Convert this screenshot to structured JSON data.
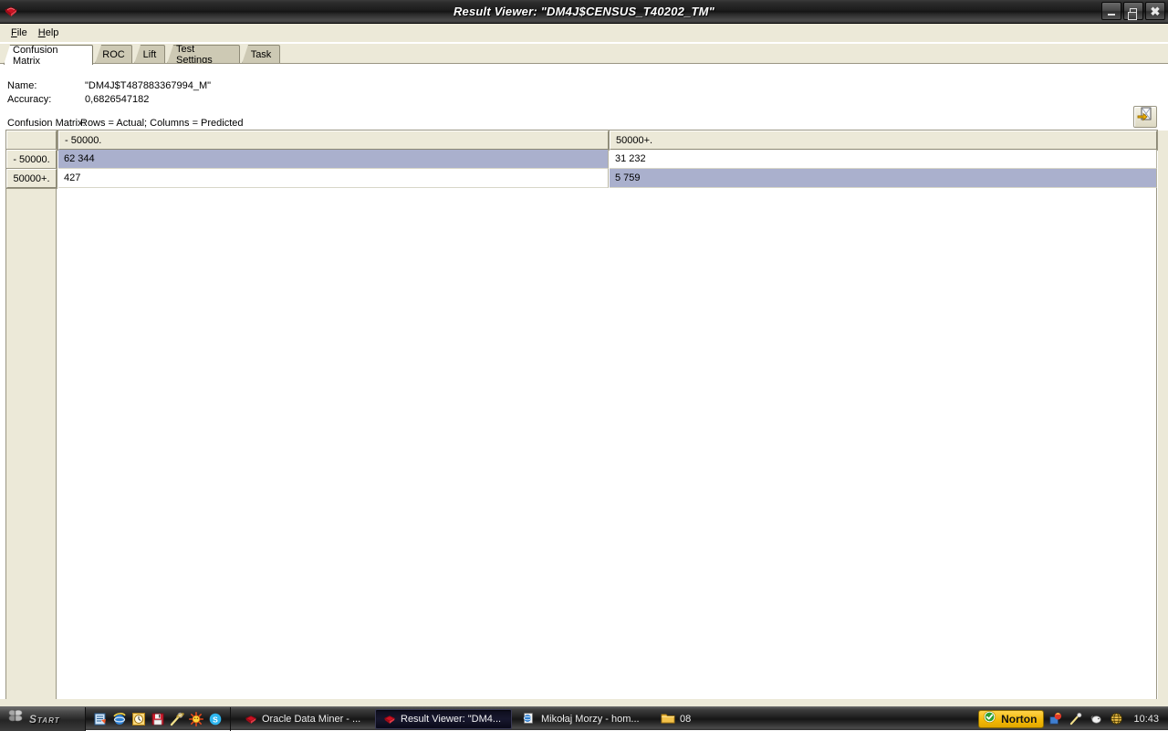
{
  "window": {
    "title": "Result Viewer: \"DM4J$CENSUS_T40202_TM\"",
    "app_icon": "oracle-data-miner-icon",
    "controls": {
      "minimize": "minimize-button",
      "restore": "restore-button",
      "close": "close-button"
    }
  },
  "menubar": {
    "items": [
      {
        "label": "File",
        "mnemonic": "F"
      },
      {
        "label": "Help",
        "mnemonic": "H"
      }
    ]
  },
  "tabs": [
    {
      "label": "Confusion Matrix",
      "active": true
    },
    {
      "label": "ROC",
      "active": false
    },
    {
      "label": "Lift",
      "active": false
    },
    {
      "label": "Test Settings",
      "active": false
    },
    {
      "label": "Task",
      "active": false
    }
  ],
  "details": {
    "name_label": "Name:",
    "name_value": "\"DM4J$T487883367994_M\"",
    "accuracy_label": "Accuracy:",
    "accuracy_value": "0,6826547182",
    "matrix_label": "Confusion Matrix:",
    "matrix_caption": "Rows = Actual; Columns = Predicted"
  },
  "toolbar": {
    "export_button_tooltip": "Export",
    "export_icon": "export-arrow-icon"
  },
  "chart_data": {
    "type": "table",
    "title": "Confusion Matrix",
    "subtitle": "Rows = Actual; Columns = Predicted",
    "corner_header": "",
    "columns": [
      "- 50000.",
      "50000+."
    ],
    "rows": [
      "- 50000.",
      "50000+."
    ],
    "values": [
      [
        "62 344",
        "31 232"
      ],
      [
        "427",
        "5 759"
      ]
    ],
    "numeric_values": [
      [
        62344,
        31232
      ],
      [
        427,
        5759
      ]
    ],
    "highlighted_cells": [
      [
        0,
        0
      ],
      [
        1,
        1
      ]
    ],
    "accuracy": 0.6826547182,
    "highlight_color": "#aab0cd",
    "header_color": "#ece9d8"
  },
  "taskbar": {
    "start_label": "Start",
    "quicklaunch": [
      "desktop-icon",
      "internet-explorer-icon",
      "clock-icon",
      "save-floppy-icon",
      "comet-icon",
      "sun-icon",
      "skype-icon"
    ],
    "buttons": [
      {
        "label": "Oracle Data Miner - ...",
        "icon": "oracle-data-miner-icon",
        "active": false
      },
      {
        "label": "Result Viewer: \"DM4...",
        "icon": "oracle-data-miner-icon",
        "active": true
      },
      {
        "label": "Mikołaj Morzy - hom...",
        "icon": "internet-explorer-icon",
        "active": false
      },
      {
        "label": "08",
        "icon": "folder-icon",
        "active": false
      }
    ],
    "tray": {
      "norton_label": "Norton",
      "norton_icon": "norton-shield-check-icon",
      "icons": [
        "tray-app-icon",
        "comet-icon",
        "mouse-icon",
        "globe-icon"
      ],
      "clock": "10:43"
    }
  },
  "colors": {
    "window_chrome": "#ece9d8",
    "tab_inactive": "#cdc9b4",
    "tab_active": "#ffffff",
    "selection": "#aab0cd",
    "titlebar": "#141414",
    "norton_yellow": "#f2b705"
  }
}
